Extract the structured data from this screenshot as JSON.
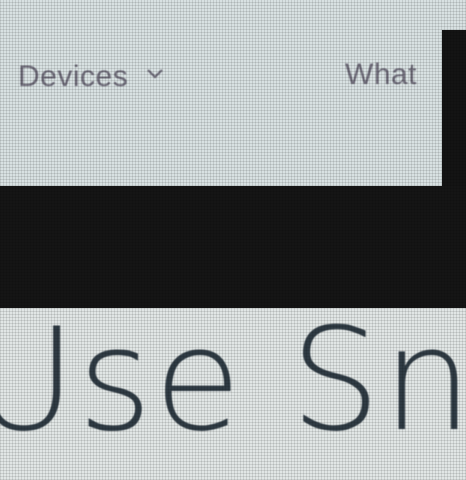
{
  "nav": {
    "devices_label": "Devices",
    "whats_new_label": "What"
  },
  "content": {
    "heading": "Use Snip"
  },
  "icons": {
    "devices_chevron": "chevron-down-icon"
  },
  "colors": {
    "nav_background": "#d8e1e2",
    "nav_text": "#6d6a78",
    "band": "#151515",
    "content_background": "#e1e6e5",
    "heading_text": "#2f3b44"
  }
}
